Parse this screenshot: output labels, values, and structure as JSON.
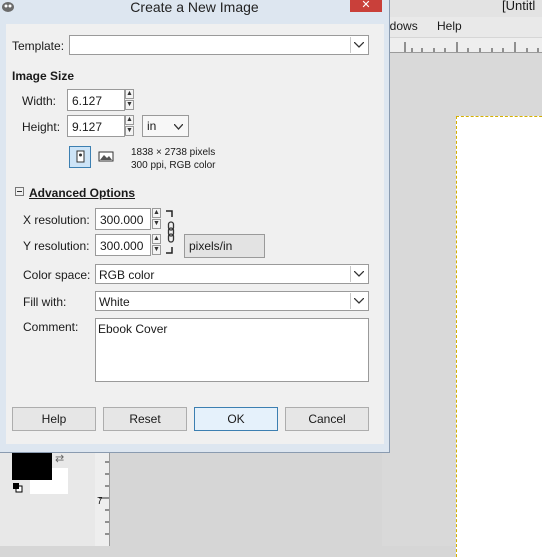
{
  "background": {
    "title": "[Untitl",
    "menu": [
      "ndows",
      "Help"
    ],
    "ruler_v_label": "7"
  },
  "dialog": {
    "title": "Create a New Image",
    "close_glyph": "✕",
    "template": {
      "label": "Template:",
      "value": ""
    },
    "image_size": {
      "heading": "Image Size",
      "width_label": "Width:",
      "width_value": "6.127",
      "height_label": "Height:",
      "height_value": "9.127",
      "unit": "in",
      "pixels_info": "1838 × 2738 pixels",
      "ppi_info": "300 ppi, RGB color"
    },
    "advanced": {
      "heading": "Advanced Options",
      "x_res_label": "X resolution:",
      "x_res_value": "300.000",
      "y_res_label": "Y resolution:",
      "y_res_value": "300.000",
      "res_unit": "pixels/in",
      "color_space_label": "Color space:",
      "color_space_value": "RGB color",
      "fill_label": "Fill with:",
      "fill_value": "White",
      "comment_label": "Comment:",
      "comment_value": "Ebook Cover"
    },
    "buttons": {
      "help": "Help",
      "reset": "Reset",
      "ok": "OK",
      "cancel": "Cancel"
    }
  },
  "colors": {
    "dialog_frame": "#dde6f0",
    "close_button": "#c9403a",
    "content_bg": "#f0f0f0"
  }
}
